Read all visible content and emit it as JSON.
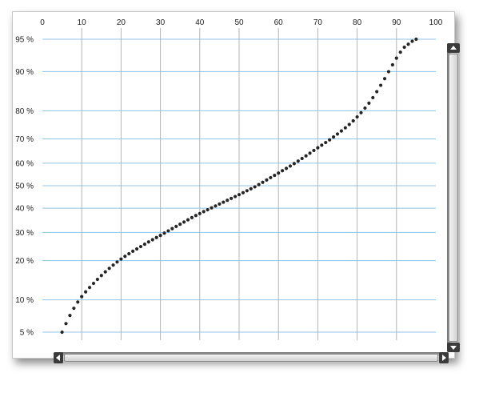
{
  "chart_data": {
    "type": "scatter",
    "title": "",
    "xlabel": "",
    "ylabel": "",
    "xlim": [
      0,
      100
    ],
    "y_scale": "normal-probability",
    "ylim_percent": [
      5,
      95
    ],
    "x_ticks": [
      "0",
      "10",
      "20",
      "30",
      "40",
      "50",
      "60",
      "70",
      "80",
      "90",
      "100"
    ],
    "y_ticks": [
      {
        "value": 5,
        "label": "5 %"
      },
      {
        "value": 10,
        "label": "10 %"
      },
      {
        "value": 20,
        "label": "20 %"
      },
      {
        "value": 30,
        "label": "30 %"
      },
      {
        "value": 40,
        "label": "40 %"
      },
      {
        "value": 50,
        "label": "50 %"
      },
      {
        "value": 60,
        "label": "60 %"
      },
      {
        "value": 70,
        "label": "70 %"
      },
      {
        "value": 80,
        "label": "80 %"
      },
      {
        "value": 90,
        "label": "90 %"
      },
      {
        "value": 95,
        "label": "95 %"
      }
    ],
    "x_axis_position": "top",
    "grid": true,
    "legend": "none",
    "series": [
      {
        "x": [
          5.0,
          6.0,
          7.0,
          8.0,
          9.0,
          10.0,
          11.0,
          12.0,
          13.0,
          14.0,
          15.0,
          16.0,
          17.0,
          18.0,
          19.0,
          20.0,
          21.0,
          22.0,
          23.0,
          24.0,
          25.0,
          26.0,
          27.0,
          28.0,
          29.0,
          30.0,
          31.0,
          32.0,
          33.0,
          34.0,
          35.0,
          36.0,
          37.0,
          38.0,
          39.0,
          40.0,
          41.0,
          42.0,
          43.0,
          44.0,
          45.0,
          46.0,
          47.0,
          48.0,
          49.0,
          50.0,
          51.0,
          52.0,
          53.0,
          54.0,
          55.0,
          56.0,
          57.0,
          58.0,
          59.0,
          60.0,
          61.0,
          62.0,
          63.0,
          64.0,
          65.0,
          66.0,
          67.0,
          68.0,
          69.0,
          70.0,
          71.0,
          72.0,
          73.0,
          74.0,
          75.0,
          76.0,
          77.0,
          78.0,
          79.0,
          80.0,
          81.0,
          82.0,
          83.0,
          84.0,
          85.0,
          86.0,
          87.0,
          88.0,
          89.0,
          90.0,
          91.0,
          92.0,
          93.0,
          94.0,
          95.0
        ],
        "y": [
          5.0,
          6.07,
          7.25,
          8.43,
          9.57,
          10.64,
          11.66,
          12.65,
          13.63,
          14.64,
          15.65,
          16.67,
          17.66,
          18.63,
          19.58,
          20.5,
          21.39,
          22.25,
          23.08,
          23.88,
          24.71,
          25.54,
          26.38,
          27.21,
          28.03,
          28.84,
          29.71,
          30.6,
          31.48,
          32.37,
          33.26,
          34.17,
          35.08,
          35.99,
          36.88,
          37.72,
          38.55,
          39.35,
          40.18,
          41.0,
          41.84,
          42.66,
          43.48,
          44.32,
          45.15,
          46.0,
          46.87,
          47.74,
          48.61,
          49.48,
          50.5,
          51.52,
          52.55,
          53.6,
          54.62,
          55.64,
          56.69,
          57.71,
          58.74,
          59.8,
          60.9,
          62.0,
          63.12,
          64.24,
          65.39,
          66.5,
          67.54,
          68.61,
          69.67,
          70.78,
          71.92,
          73.06,
          74.21,
          75.42,
          76.68,
          78.01,
          79.38,
          80.82,
          82.31,
          83.86,
          85.46,
          87.02,
          88.53,
          89.98,
          91.27,
          92.4,
          93.31,
          94.0,
          94.39,
          94.76,
          95.0
        ]
      }
    ],
    "colors": {
      "gridline": "#8fc4e8",
      "vertical_gridline": "#b4b4b4",
      "marker": "#262626"
    }
  }
}
